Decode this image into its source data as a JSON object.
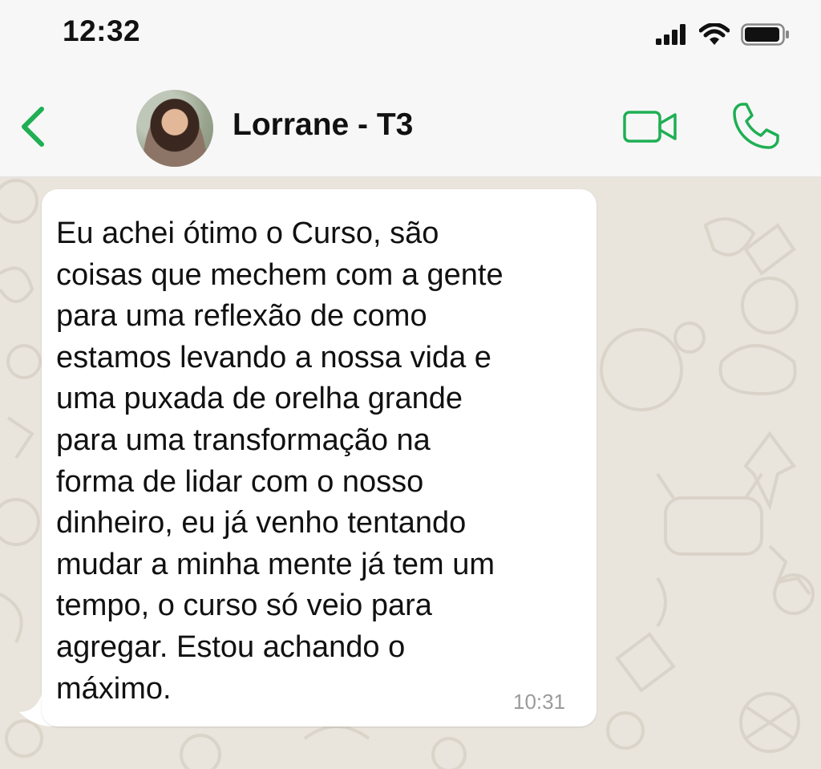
{
  "status_bar": {
    "time": "12:32"
  },
  "header": {
    "contact_name": "Lorrane - T3"
  },
  "message": {
    "text": "Eu achei ótimo o Curso, são\ncoisas que mechem com a gente\npara uma reflexão de como\nestamos levando a nossa vida e\numa puxada de orelha grande\npara uma transformação na\nforma de lidar com o nosso\ndinheiro, eu já venho tentando\nmudar a minha mente já tem um\ntempo, o curso só veio para\nagregar. Estou achando o\nmáximo.",
    "time": "10:31"
  },
  "colors": {
    "accent_green": "#1faf54",
    "chat_background": "#e9e4dc",
    "header_background": "#f7f7f7"
  },
  "icons": {
    "back": "chevron-left-icon",
    "video": "video-camera-icon",
    "call": "phone-icon",
    "signal": "signal-icon",
    "wifi": "wifi-icon",
    "battery": "battery-icon"
  }
}
